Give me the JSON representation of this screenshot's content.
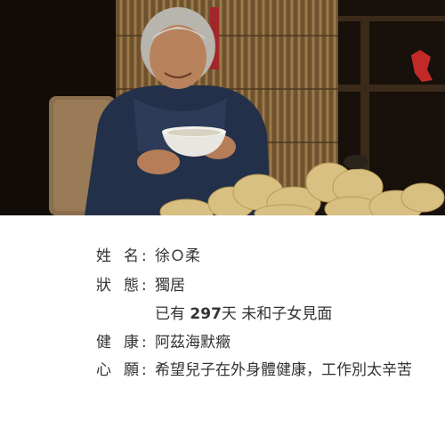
{
  "photo": {
    "description_icon": "elderly-woman-photo",
    "colors": {
      "background": "#1c140e",
      "bamboo": "#8b6a3c",
      "jacket": "#23304a",
      "buns": "#d8c083"
    }
  },
  "profile": {
    "name": {
      "label_chars": [
        "姓",
        "名"
      ],
      "colon": ":",
      "value": "徐Ｏ柔"
    },
    "status": {
      "label_chars": [
        "狀",
        "態"
      ],
      "colon": ":",
      "value": "獨居"
    },
    "days": {
      "prefix": "已有 ",
      "number": "297",
      "suffix": "天 未和子女見面"
    },
    "health": {
      "label_chars": [
        "健",
        "康"
      ],
      "colon": ":",
      "value": "阿茲海默癥"
    },
    "wish": {
      "label_chars": [
        "心",
        "願"
      ],
      "colon": ":",
      "value": "希望兒子在外身體健康，工作別太辛苦"
    }
  }
}
